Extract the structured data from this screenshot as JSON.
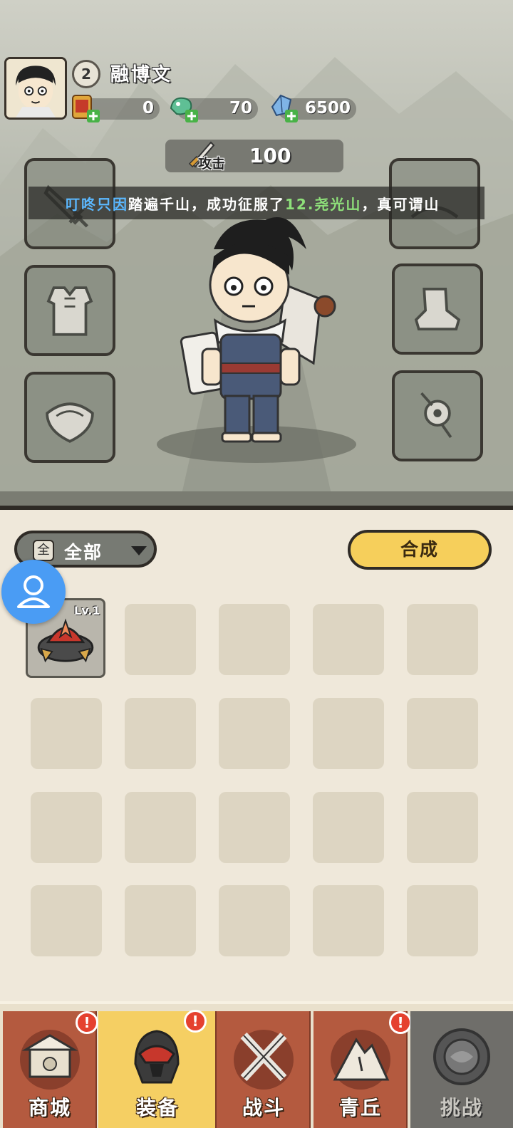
{
  "player": {
    "level": "2",
    "name": "融博文"
  },
  "resources": [
    {
      "icon": "scroll-token-icon",
      "value": "0"
    },
    {
      "icon": "jade-dragon-icon",
      "value": "70"
    },
    {
      "icon": "crystal-icon",
      "value": "6500"
    }
  ],
  "attack": {
    "label": "攻击",
    "value": "100"
  },
  "marquee": {
    "player": "叮咚只因",
    "text1": "踏遍千山，成功征服了",
    "mountain": "12.尧光山",
    "text2": "，真可谓山"
  },
  "equipment_slots": [
    "sword-slot-icon",
    "hat-slot-icon",
    "armor-slot-icon",
    "boots-slot-icon",
    "necklace-slot-icon",
    "accessory-slot-icon"
  ],
  "inventory": {
    "filter_chip": "全",
    "filter_label": "全部",
    "merge_label": "合成",
    "item_level": "Lv.1"
  },
  "nav": {
    "tabs": [
      {
        "label": "商城",
        "icon": "shop-icon",
        "badge": "!"
      },
      {
        "label": "装备",
        "icon": "helmet-icon",
        "badge": "!"
      },
      {
        "label": "战斗",
        "icon": "crossed-swords-icon",
        "badge": ""
      },
      {
        "label": "青丘",
        "icon": "mountain-icon",
        "badge": "!"
      },
      {
        "label": "挑战",
        "icon": "challenge-orb-icon",
        "badge": ""
      }
    ]
  },
  "colors": {
    "accent_yellow": "#f6cf5b",
    "tab_red": "#b45a3f",
    "highlight_blue": "#5bb8ff",
    "highlight_green": "#8ee07a"
  }
}
